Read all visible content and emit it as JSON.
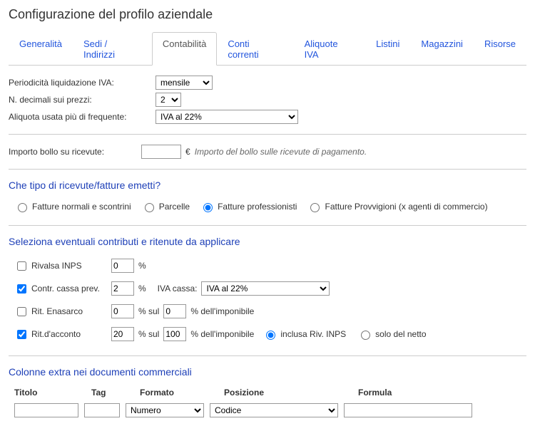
{
  "title": "Configurazione del profilo aziendale",
  "tabs": [
    {
      "label": "Generalità"
    },
    {
      "label": "Sedi / Indirizzi"
    },
    {
      "label": "Contabilità"
    },
    {
      "label": "Conti correnti"
    },
    {
      "label": "Aliquote IVA"
    },
    {
      "label": "Listini"
    },
    {
      "label": "Magazzini"
    },
    {
      "label": "Risorse"
    }
  ],
  "fields": {
    "periodicita_label": "Periodicità liquidazione IVA:",
    "periodicita_value": "mensile",
    "decimali_label": "N. decimali sui prezzi:",
    "decimali_value": "2",
    "aliquota_freq_label": "Aliquota usata più di frequente:",
    "aliquota_freq_value": "IVA al 22%",
    "bollo_label": "Importo bollo su ricevute:",
    "bollo_value": "",
    "bollo_currency": "€",
    "bollo_hint": "Importo del bollo sulle ricevute di pagamento."
  },
  "tipo_ricevute": {
    "title": "Che tipo di ricevute/fatture emetti?",
    "options": [
      {
        "label": "Fatture normali e scontrini",
        "checked": false
      },
      {
        "label": "Parcelle",
        "checked": false
      },
      {
        "label": "Fatture professionisti",
        "checked": true
      },
      {
        "label": "Fatture Provvigioni (x agenti di commercio)",
        "checked": false
      }
    ]
  },
  "contributi": {
    "title": "Seleziona eventuali contributi e ritenute da applicare",
    "rivalsa_inps": {
      "label": "Rivalsa INPS",
      "checked": false,
      "pct": "0"
    },
    "cassa_prev": {
      "label": "Contr. cassa prev.",
      "checked": true,
      "pct": "2",
      "iva_cassa_label": "IVA cassa:",
      "iva_cassa_value": "IVA al 22%"
    },
    "enasarco": {
      "label": "Rit. Enasarco",
      "checked": false,
      "pct": "0",
      "sul_label": "% sul",
      "imp_pct": "0",
      "imp_suffix": "% dell'imponibile"
    },
    "acconto": {
      "label": "Rit.d'acconto",
      "checked": true,
      "pct": "20",
      "sul_label": "% sul",
      "imp_pct": "100",
      "imp_suffix": "% dell'imponibile",
      "radio": [
        {
          "label": "inclusa Riv. INPS",
          "checked": true
        },
        {
          "label": "solo del netto",
          "checked": false
        }
      ]
    }
  },
  "colonne_extra": {
    "title": "Colonne extra nei documenti commerciali",
    "headers": {
      "titolo": "Titolo",
      "tag": "Tag",
      "formato": "Formato",
      "posizione": "Posizione",
      "formula": "Formula"
    },
    "row": {
      "titolo": "",
      "tag": "",
      "formato": "Numero",
      "posizione": "Codice",
      "formula": ""
    }
  },
  "pct_sign": "%"
}
